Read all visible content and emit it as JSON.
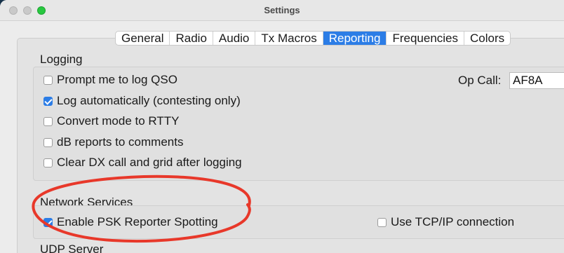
{
  "window": {
    "title": "Settings"
  },
  "tabs": [
    {
      "label": "General"
    },
    {
      "label": "Radio"
    },
    {
      "label": "Audio"
    },
    {
      "label": "Tx Macros"
    },
    {
      "label": "Reporting"
    },
    {
      "label": "Frequencies"
    },
    {
      "label": "Colors"
    }
  ],
  "active_tab": "Reporting",
  "logging": {
    "title": "Logging",
    "options": [
      {
        "label": "Prompt me to log QSO",
        "checked": false
      },
      {
        "label": "Log automatically (contesting only)",
        "checked": true
      },
      {
        "label": "Convert mode to RTTY",
        "checked": false
      },
      {
        "label": "dB reports to comments",
        "checked": false
      },
      {
        "label": "Clear DX call and grid after logging",
        "checked": false
      }
    ],
    "op_call_label": "Op Call:",
    "op_call_value": "AF8A"
  },
  "network": {
    "title": "Network Services",
    "psk_label": "Enable PSK Reporter Spotting",
    "psk_checked": true,
    "tcp_label": "Use TCP/IP connection",
    "tcp_checked": false
  },
  "udp": {
    "title": "UDP Server"
  },
  "colors": {
    "accent": "#2c7de6",
    "annotation": "#e8382a"
  }
}
